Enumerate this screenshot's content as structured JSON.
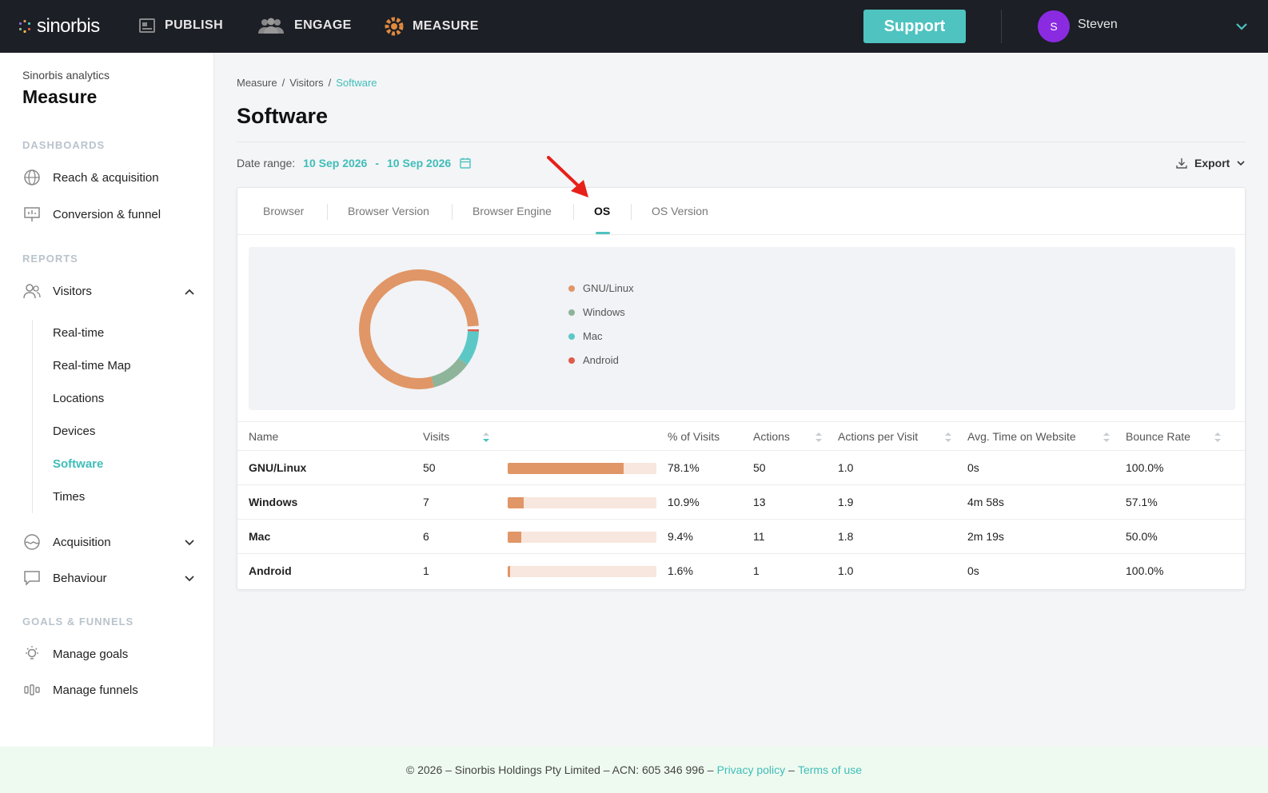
{
  "topbar": {
    "brand": "sinorbis",
    "nav": [
      {
        "label": "PUBLISH",
        "icon": "publish-icon"
      },
      {
        "label": "ENGAGE",
        "icon": "engage-icon"
      },
      {
        "label": "MEASURE",
        "icon": "measure-icon"
      }
    ],
    "support_label": "Support",
    "avatar_initial": "S",
    "user_name": "Steven"
  },
  "sidebar": {
    "subtitle": "Sinorbis analytics",
    "title": "Measure",
    "sections": {
      "dashboards": "DASHBOARDS",
      "reports": "REPORTS",
      "goals": "GOALS & FUNNELS"
    },
    "dashboards": [
      {
        "label": "Reach & acquisition",
        "icon": "globe-icon"
      },
      {
        "label": "Conversion & funnel",
        "icon": "presentation-icon"
      }
    ],
    "visitors_label": "Visitors",
    "visitors_sub": [
      "Real-time",
      "Real-time Map",
      "Locations",
      "Devices",
      "Software",
      "Times"
    ],
    "active_sub": "Software",
    "acquisition_label": "Acquisition",
    "behaviour_label": "Behaviour",
    "goals": [
      {
        "label": "Manage goals",
        "icon": "lightbulb-icon"
      },
      {
        "label": "Manage funnels",
        "icon": "funnel-icon"
      }
    ]
  },
  "main": {
    "breadcrumb": [
      "Measure",
      "Visitors",
      "Software"
    ],
    "page_title": "Software",
    "date_range_label": "Date range:",
    "date_from": "10 Sep 2026",
    "date_sep": "-",
    "date_to": "10 Sep 2026",
    "export_label": "Export",
    "tabs": [
      "Browser",
      "Browser Version",
      "Browser Engine",
      "OS",
      "OS Version"
    ],
    "active_tab": "OS"
  },
  "colors": {
    "gnu_linux": "#e09666",
    "windows": "#8eb49a",
    "mac": "#5bc8c6",
    "android": "#e05b4a",
    "accent": "#4ec3c0"
  },
  "chart_data": {
    "type": "pie",
    "categories": [
      "GNU/Linux",
      "Windows",
      "Mac",
      "Android"
    ],
    "values": [
      78.1,
      10.9,
      9.4,
      1.6
    ],
    "legend_position": "right"
  },
  "table": {
    "headers": [
      "Name",
      "Visits",
      "% of Visits",
      "Actions",
      "Actions per Visit",
      "Avg. Time on Website",
      "Bounce Rate"
    ],
    "rows": [
      {
        "name": "GNU/Linux",
        "visits": "50",
        "pct": "78.1%",
        "share": 0.781,
        "actions": "50",
        "apv": "1.0",
        "avg_time": "0s",
        "bounce": "100.0%"
      },
      {
        "name": "Windows",
        "visits": "7",
        "pct": "10.9%",
        "share": 0.109,
        "actions": "13",
        "apv": "1.9",
        "avg_time": "4m 58s",
        "bounce": "57.1%"
      },
      {
        "name": "Mac",
        "visits": "6",
        "pct": "9.4%",
        "share": 0.094,
        "actions": "11",
        "apv": "1.8",
        "avg_time": "2m 19s",
        "bounce": "50.0%"
      },
      {
        "name": "Android",
        "visits": "1",
        "pct": "1.6%",
        "share": 0.016,
        "actions": "1",
        "apv": "1.0",
        "avg_time": "0s",
        "bounce": "100.0%"
      }
    ]
  },
  "footer": {
    "copyright": "© 2026 – Sinorbis Holdings Pty Limited – ACN: 605 346 996 –",
    "privacy": "Privacy policy",
    "dash": "–",
    "terms": "Terms of use"
  }
}
